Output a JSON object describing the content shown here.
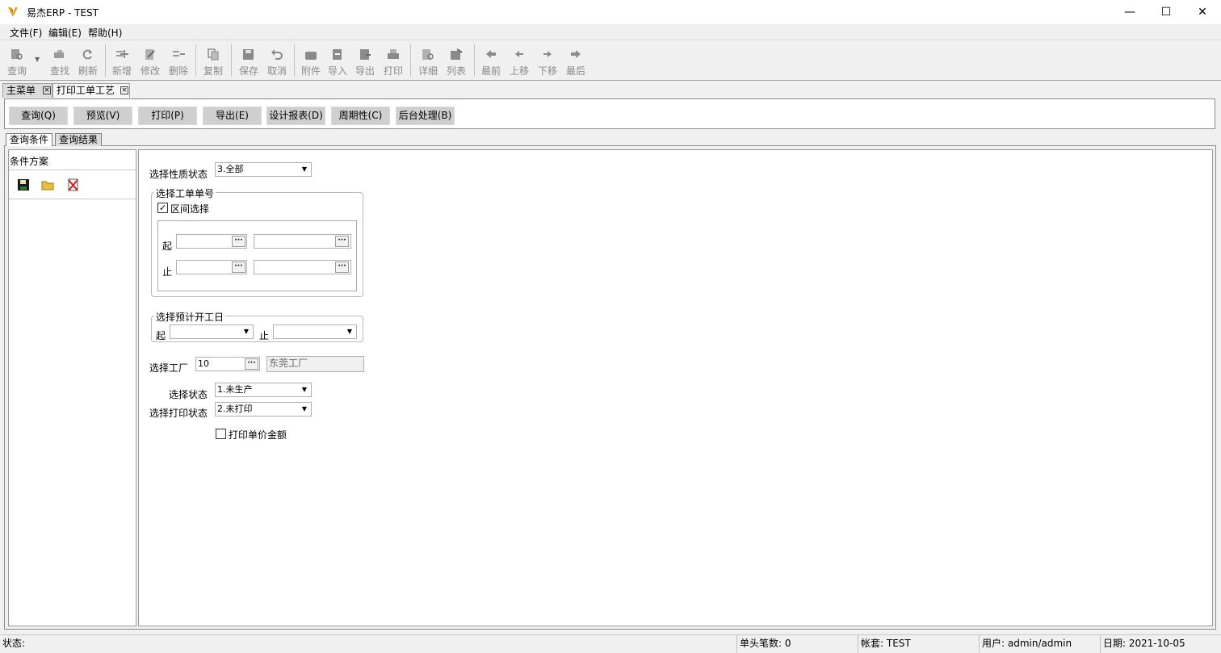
{
  "window": {
    "title": "易杰ERP - TEST",
    "min": "—",
    "max": "☐",
    "close": "✕"
  },
  "menu": [
    "文件(F)",
    "编辑(E)",
    "帮助(H)"
  ],
  "toolbar": {
    "query": "查询",
    "find": "查找",
    "refresh": "刷新",
    "add": "新增",
    "edit": "修改",
    "delete": "删除",
    "copy": "复制",
    "save": "保存",
    "cancel": "取消",
    "attach": "附件",
    "import": "导入",
    "export": "导出",
    "print": "打印",
    "detail": "详细",
    "list": "列表",
    "first": "最前",
    "prev": "上移",
    "next": "下移",
    "last": "最后"
  },
  "doc_tabs": [
    "主菜单",
    "打印工单工艺"
  ],
  "commands": [
    "查询(Q)",
    "预览(V)",
    "打印(P)",
    "导出(E)",
    "设计报表(D)",
    "周期性(C)",
    "后台处理(B)"
  ],
  "sub_tabs": [
    "查询条件",
    "查询结果"
  ],
  "left_panel": {
    "title": "条件方案"
  },
  "form": {
    "nature_label": "选择性质状态",
    "nature_value": "3.全部",
    "wo_group": "选择工单单号",
    "range_label": "区间选择",
    "range_checked": true,
    "from": "起",
    "to": "止",
    "date_group": "选择预计开工日",
    "date_from": "起",
    "date_to": "止",
    "factory_label": "选择工厂",
    "factory_code": "10",
    "factory_name": "东莞工厂",
    "status_label": "选择状态",
    "status_value": "1.未生产",
    "print_status_label": "选择打印状态",
    "print_status_value": "2.未打印",
    "print_price_label": "打印单价金额",
    "print_price_checked": false
  },
  "status_bar": {
    "status": "状态:",
    "count": "单头笔数: 0",
    "account": "帐套: TEST",
    "user": "用户: admin/admin",
    "date": "日期: 2021-10-05"
  }
}
